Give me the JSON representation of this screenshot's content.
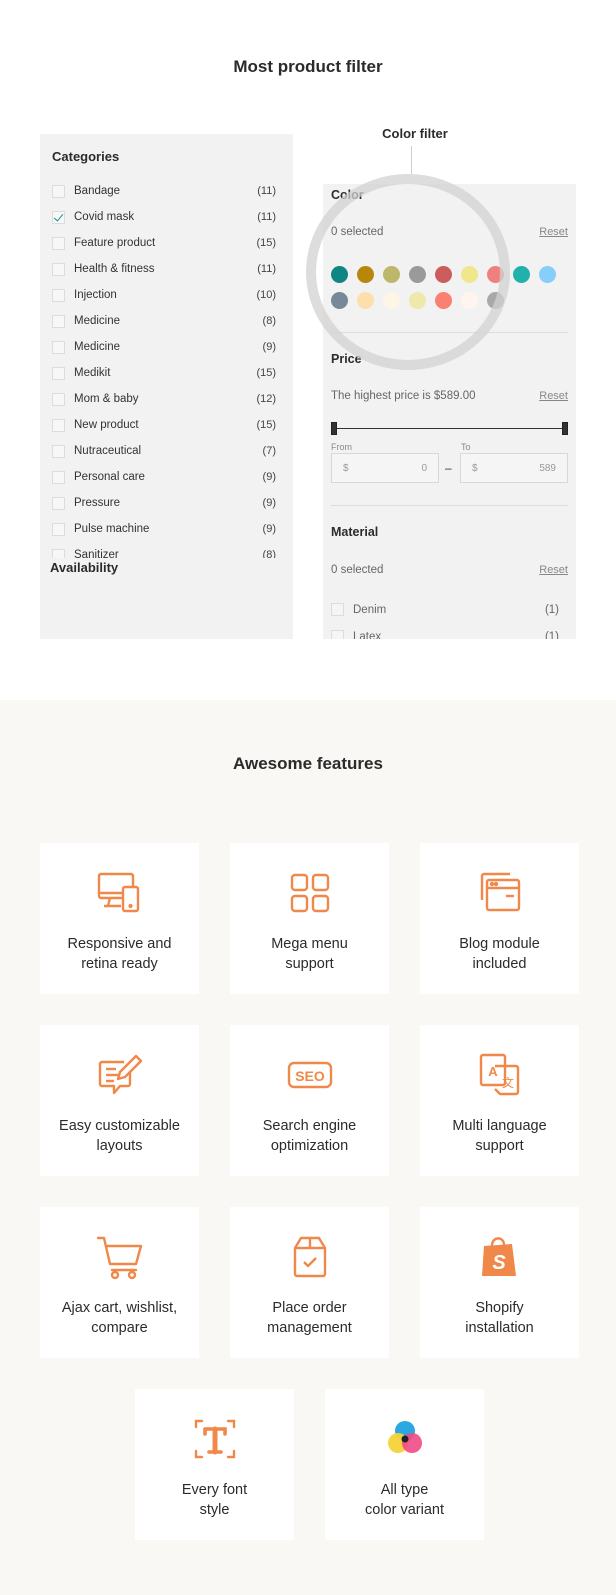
{
  "sections": {
    "filter_title": "Most product filter",
    "features_title": "Awesome features"
  },
  "categories": {
    "title": "Categories",
    "items": [
      {
        "label": "Bandage",
        "count": "(11)",
        "checked": false
      },
      {
        "label": "Covid mask",
        "count": "(11)",
        "checked": true
      },
      {
        "label": "Feature product",
        "count": "(15)",
        "checked": false
      },
      {
        "label": "Health & fitness",
        "count": "(11)",
        "checked": false
      },
      {
        "label": "Injection",
        "count": "(10)",
        "checked": false
      },
      {
        "label": "Medicine",
        "count": "(8)",
        "checked": false
      },
      {
        "label": "Medicine",
        "count": "(9)",
        "checked": false
      },
      {
        "label": "Medikit",
        "count": "(15)",
        "checked": false
      },
      {
        "label": "Mom & baby",
        "count": "(12)",
        "checked": false
      },
      {
        "label": "New product",
        "count": "(15)",
        "checked": false
      },
      {
        "label": "Nutraceutical",
        "count": "(7)",
        "checked": false
      },
      {
        "label": "Personal care",
        "count": "(9)",
        "checked": false
      },
      {
        "label": "Pressure",
        "count": "(9)",
        "checked": false
      },
      {
        "label": "Pulse machine",
        "count": "(9)",
        "checked": false
      },
      {
        "label": "Sanitizer",
        "count": "(8)",
        "checked": false
      }
    ],
    "availability_title": "Availability"
  },
  "color_filter": {
    "callout": "Color filter",
    "title": "Color",
    "selected": "0 selected",
    "reset": "Reset",
    "swatches_row1": [
      "#0f8584",
      "#b8860b",
      "#bdb76b",
      "#9a9a9a",
      "#cd5c5c",
      "#f0e68c",
      "#f08080",
      "#20b2aa",
      "#87cefa"
    ],
    "swatches_row2": [
      "#778899",
      "#ffdead",
      "#fdf5e6",
      "#eee8aa",
      "#fa8072",
      "#fff5ee",
      "#a9a9a9"
    ]
  },
  "price_filter": {
    "title": "Price",
    "highest": "The highest price is $589.00",
    "reset": "Reset",
    "from_label": "From",
    "to_label": "To",
    "currency": "$",
    "from_value": "0",
    "to_value": "589",
    "dash": "–"
  },
  "material_filter": {
    "title": "Material",
    "selected": "0 selected",
    "reset": "Reset",
    "items": [
      {
        "label": "Denim",
        "count": "(1)"
      },
      {
        "label": "Latex",
        "count": "(1)"
      }
    ]
  },
  "accent_color": "#f0884a",
  "features": [
    {
      "label": "Responsive and\nretina ready",
      "icon": "devices-icon"
    },
    {
      "label": "Mega menu\nsupport",
      "icon": "grid-icon"
    },
    {
      "label": "Blog module\nincluded",
      "icon": "browser-windows-icon"
    },
    {
      "label": "Easy customizable\nlayouts",
      "icon": "edit-note-icon"
    },
    {
      "label": "Search engine\noptimization",
      "icon": "seo-icon"
    },
    {
      "label": "Multi language\nsupport",
      "icon": "translate-icon"
    },
    {
      "label": "Ajax cart, wishlist,\ncompare",
      "icon": "cart-icon"
    },
    {
      "label": "Place order\nmanagement",
      "icon": "order-box-icon"
    },
    {
      "label": "Shopify\ninstallation",
      "icon": "shopify-bag-icon"
    },
    {
      "label": "Every font\nstyle",
      "icon": "font-icon"
    },
    {
      "label": "All type\ncolor variant",
      "icon": "color-variant-icon"
    }
  ]
}
